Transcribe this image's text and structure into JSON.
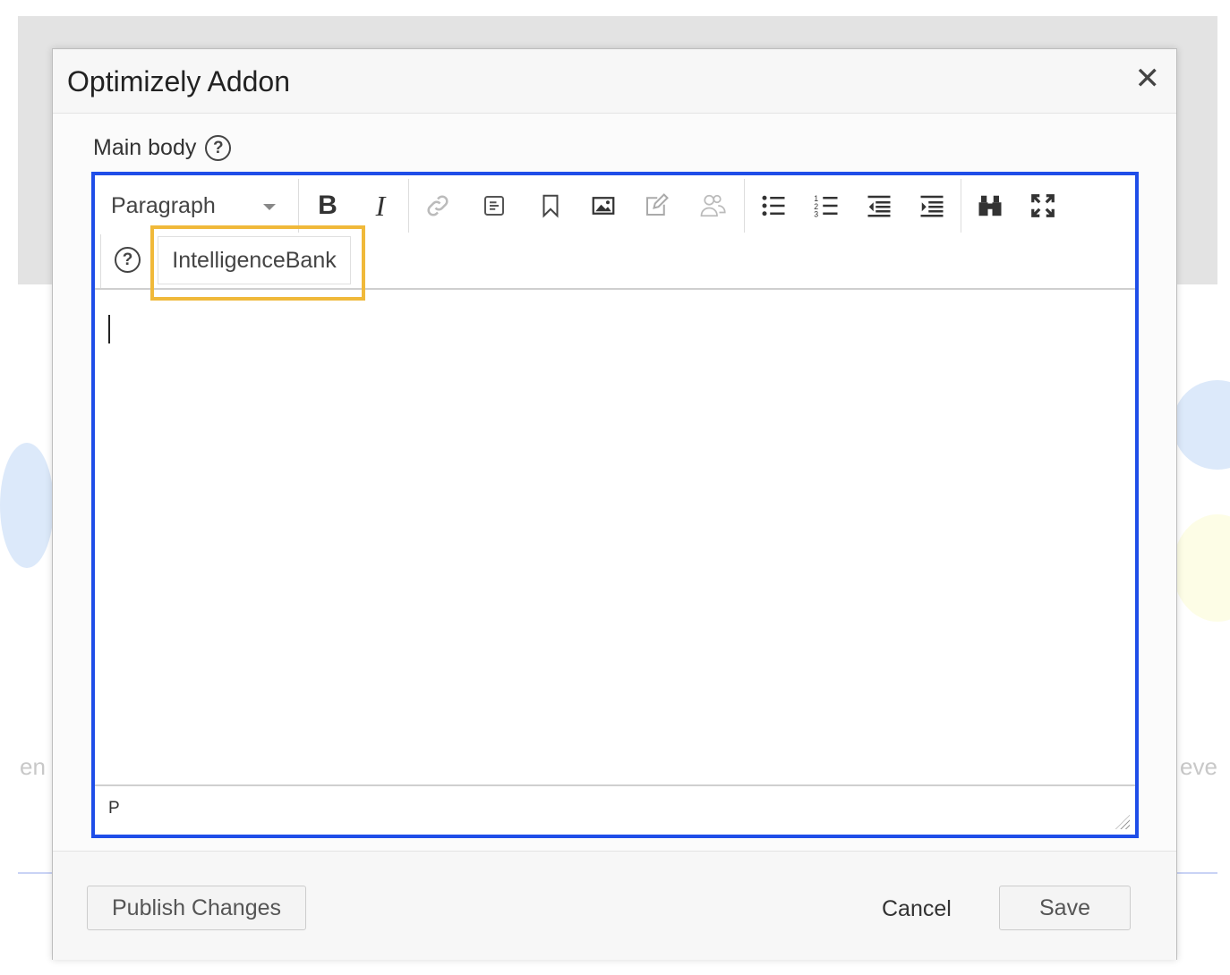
{
  "modal": {
    "title": "Optimizely Addon"
  },
  "field": {
    "label": "Main body"
  },
  "toolbar": {
    "block_format": "Paragraph",
    "buttons": [
      "bold",
      "italic",
      "link",
      "template",
      "bookmark",
      "image",
      "edit",
      "users",
      "bulleted-list",
      "numbered-list",
      "outdent",
      "indent",
      "find",
      "fullscreen"
    ],
    "addon_button": "IntelligenceBank"
  },
  "statusbar": {
    "path": "P"
  },
  "footer": {
    "publish": "Publish Changes",
    "cancel": "Cancel",
    "save": "Save"
  },
  "background": {
    "left_text": "en",
    "right_text": "eve"
  },
  "colors": {
    "focus_border": "#1f4ee8",
    "highlight": "#f0b93a"
  }
}
